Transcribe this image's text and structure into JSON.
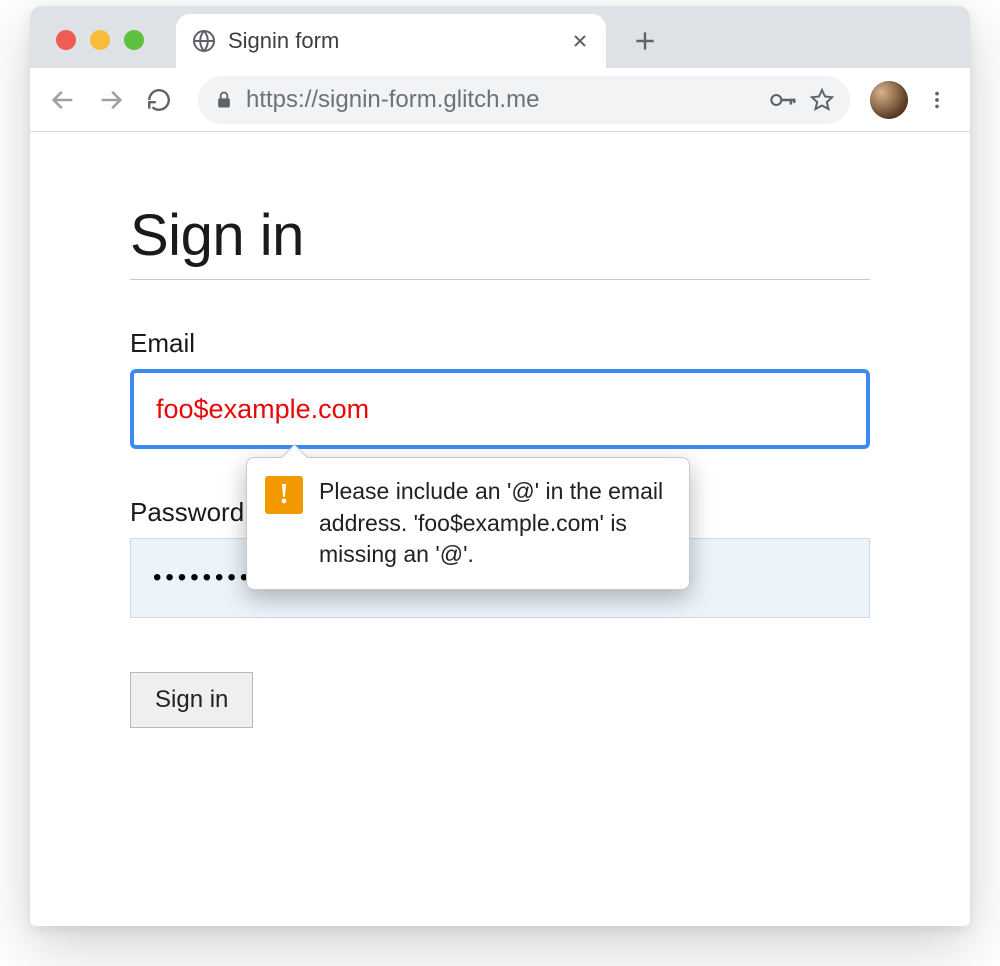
{
  "browser": {
    "tab_title": "Signin form",
    "url": "https://signin-form.glitch.me"
  },
  "page": {
    "heading": "Sign in",
    "email_label": "Email",
    "email_value": "foo$example.com",
    "password_label": "Password",
    "password_value": "•••••••••••",
    "submit_label": "Sign in",
    "validation_message": "Please include an '@' in the email address. 'foo$example.com' is missing an '@'."
  },
  "icons": {
    "warning_glyph": "!"
  }
}
